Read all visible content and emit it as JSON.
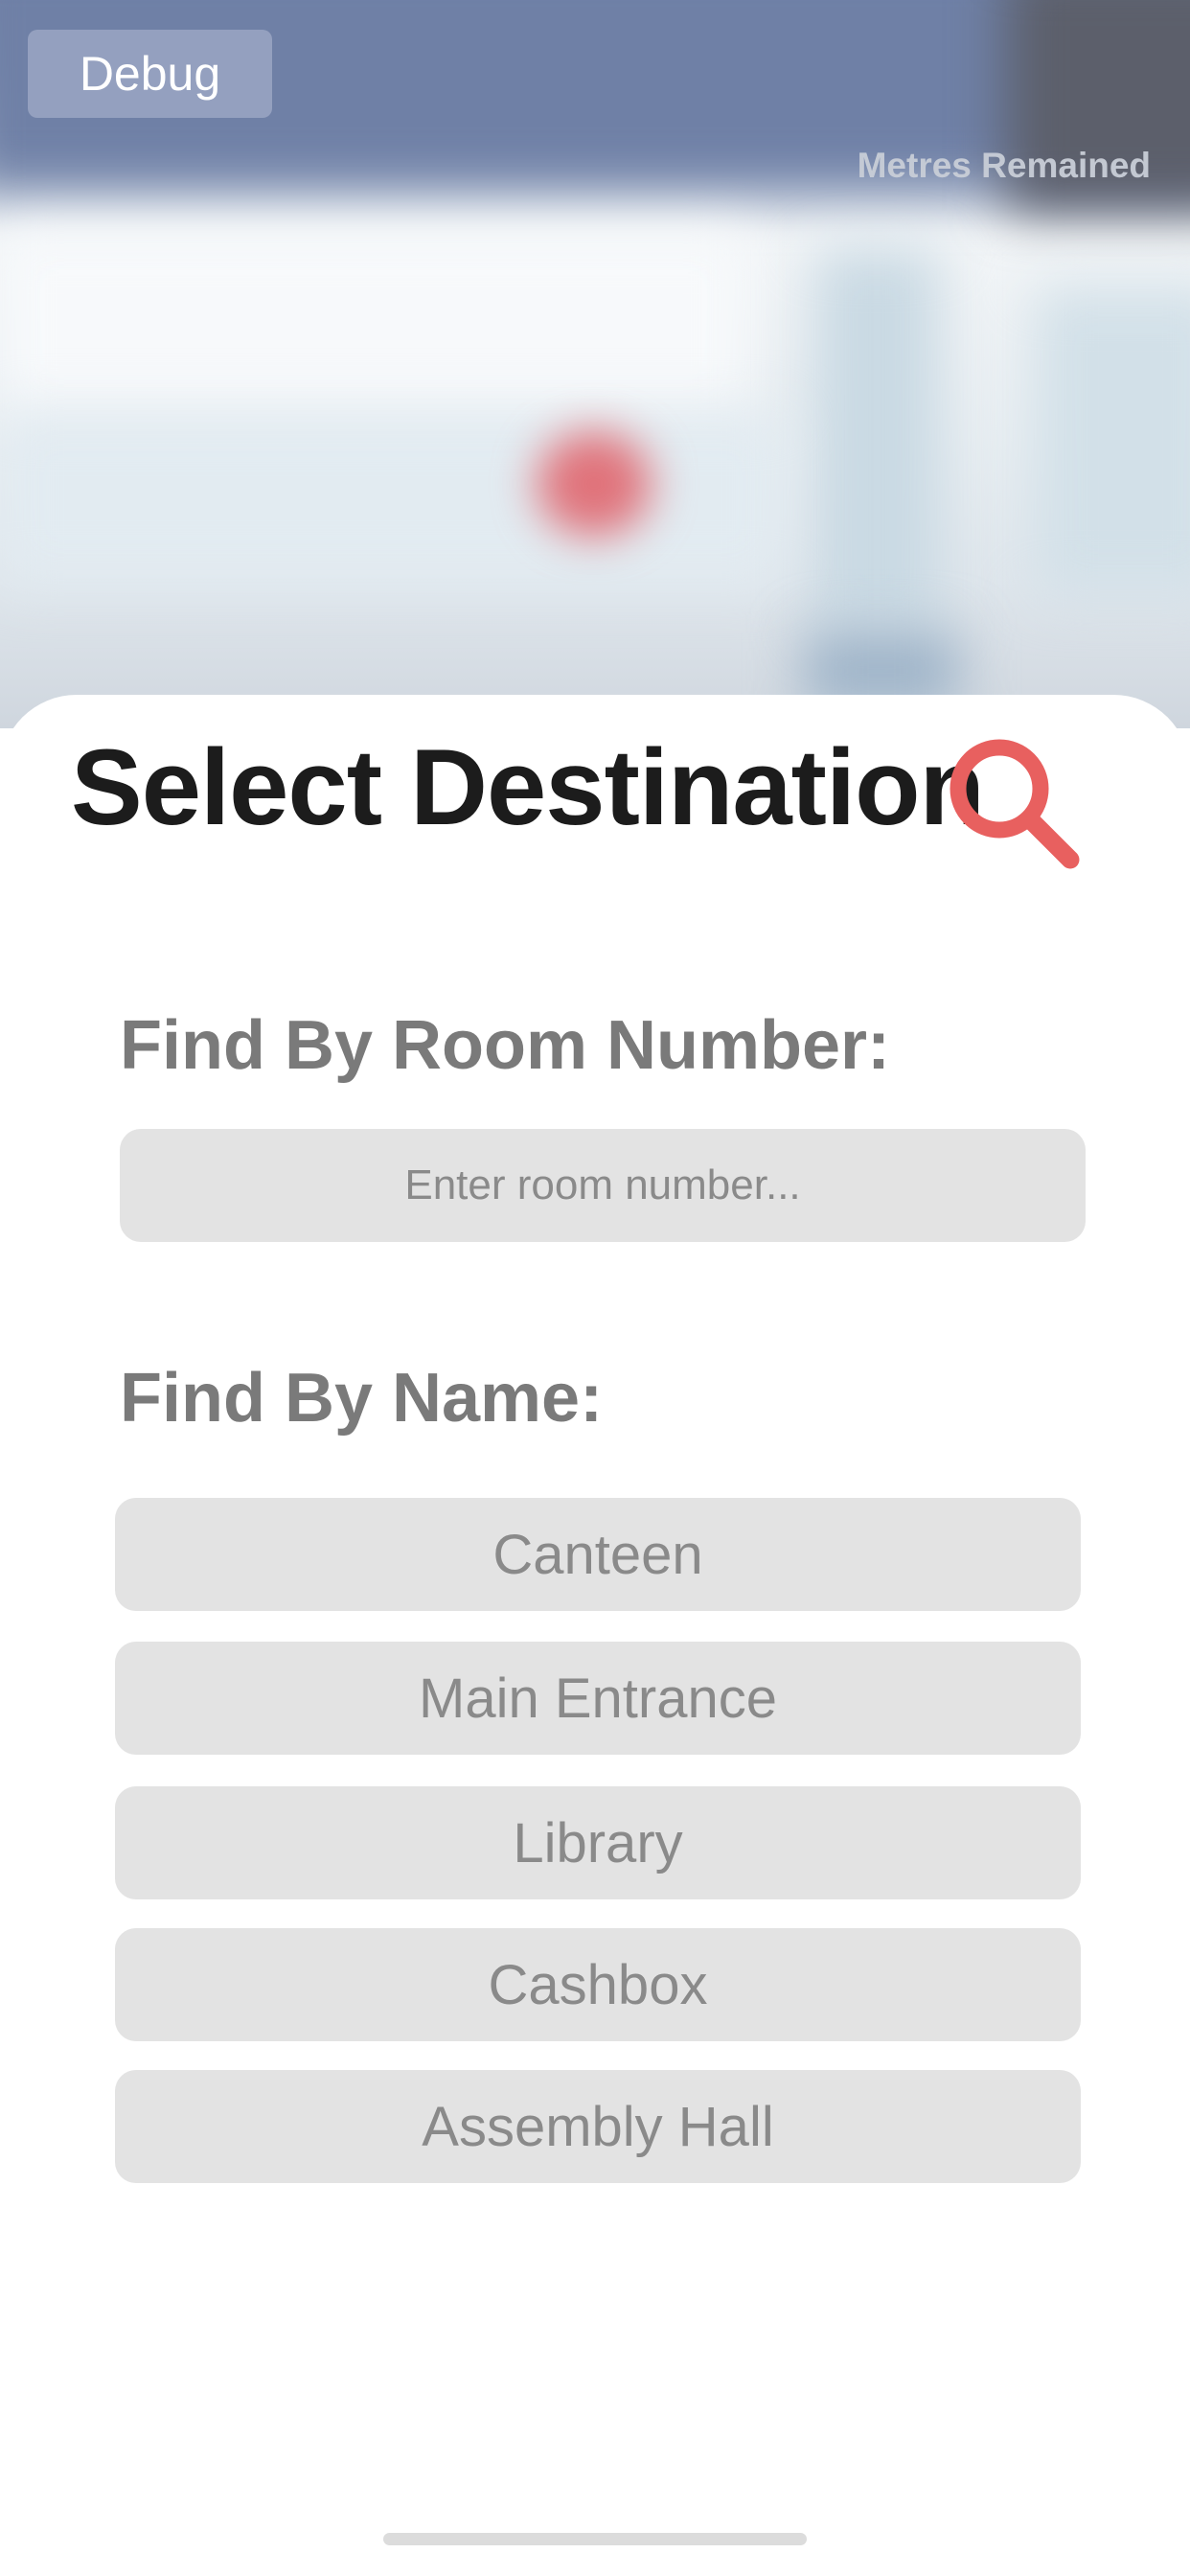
{
  "camera": {
    "debug_label": "Debug",
    "metres_label": "Metres Remained"
  },
  "sheet": {
    "title": "Select Destination",
    "search_icon": "search-icon",
    "accent_color": "#e8605f",
    "room_section": {
      "label": "Find By Room Number:",
      "input_placeholder": "Enter room number...",
      "input_value": ""
    },
    "name_section": {
      "label": "Find By Name:",
      "destinations": [
        "Canteen",
        "Main Entrance",
        "Library",
        "Cashbox",
        "Assembly Hall"
      ]
    }
  }
}
